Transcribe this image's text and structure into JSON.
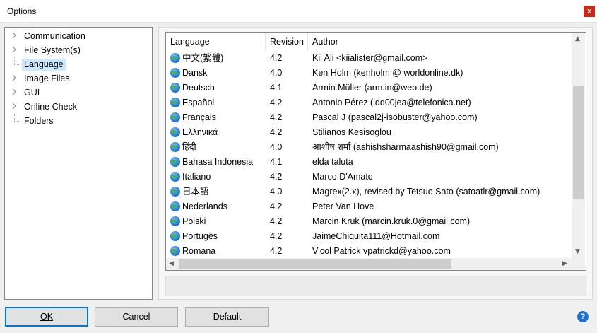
{
  "window": {
    "title": "Options",
    "close_glyph": "x"
  },
  "tree": {
    "items": [
      {
        "label": "Communication",
        "expandable": true
      },
      {
        "label": "File System(s)",
        "expandable": true
      },
      {
        "label": "Language",
        "expandable": false,
        "selected": true
      },
      {
        "label": "Image Files",
        "expandable": true
      },
      {
        "label": "GUI",
        "expandable": true
      },
      {
        "label": "Online Check",
        "expandable": true
      },
      {
        "label": "Folders",
        "expandable": false
      }
    ]
  },
  "languages": {
    "columns": [
      "Language",
      "Revision",
      "Author"
    ],
    "rows": [
      {
        "language": "中文(繁體)",
        "revision": "4.2",
        "author": "Kii Ali <kiialister@gmail.com>"
      },
      {
        "language": "Dansk",
        "revision": "4.0",
        "author": "Ken Holm (kenholm @ worldonline.dk)"
      },
      {
        "language": "Deutsch",
        "revision": "4.1",
        "author": "Armin Müller (arm.in@web.de)"
      },
      {
        "language": "Español",
        "revision": "4.2",
        "author": "Antonio Pérez (idd00jea@telefonica.net)"
      },
      {
        "language": "Français",
        "revision": "4.2",
        "author": "Pascal J  (pascal2j-isobuster@yahoo.com)"
      },
      {
        "language": "Ελληνικά",
        "revision": "4.2",
        "author": "Stilianos Kesisoglou"
      },
      {
        "language": "हिंदी",
        "revision": "4.0",
        "author": "आशीष शर्मा (ashishsharmaashish90@gmail.com)"
      },
      {
        "language": "Bahasa Indonesia",
        "revision": "4.1",
        "author": "elda taluta"
      },
      {
        "language": "Italiano",
        "revision": "4.2",
        "author": "Marco D'Amato"
      },
      {
        "language": "日本語",
        "revision": "4.0",
        "author": "Magrex(2.x), revised by Tetsuo Sato (satoatlr@gmail.com)"
      },
      {
        "language": "Nederlands",
        "revision": "4.2",
        "author": "Peter Van Hove"
      },
      {
        "language": "Polski",
        "revision": "4.2",
        "author": "Marcin Kruk (marcin.kruk.0@gmail.com)"
      },
      {
        "language": "Portugês",
        "revision": "4.2",
        "author": "JaimeChiquita111@Hotmail.com"
      },
      {
        "language": "Romana",
        "revision": "4.2",
        "author": "Vicol Patrick vpatrickd@yahoo.com"
      }
    ],
    "row_icon": "globe-icon"
  },
  "buttons": {
    "ok": "OK",
    "cancel": "Cancel",
    "default": "Default",
    "help": "?"
  },
  "colors": {
    "accent": "#0078d7",
    "selection": "#cce8ff",
    "close": "#c42b1c",
    "help": "#1e73d2"
  }
}
